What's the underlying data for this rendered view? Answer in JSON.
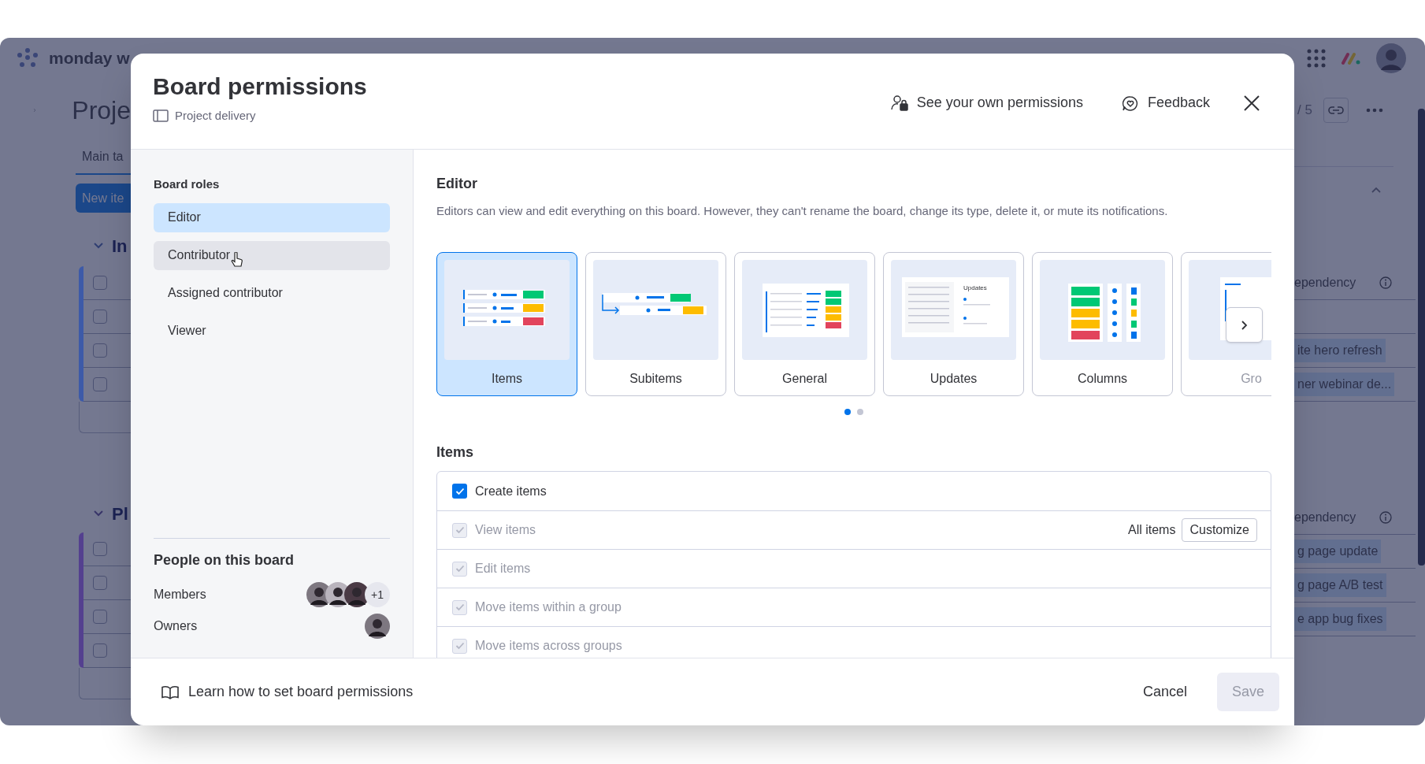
{
  "background_app": {
    "logo": "monday w",
    "board_title": "Proje",
    "view_tab": "Main ta",
    "new_item_button": "New ite",
    "page_counter": "/ 5",
    "groups": [
      {
        "name": "In",
        "color": "#3d5aa8",
        "dependency_header": "ependency",
        "cells": [
          "",
          "ite hero refresh",
          "ner webinar de..."
        ],
        "rows": [
          {
            "checked": false
          },
          {
            "checked": false
          },
          {
            "checked": false
          },
          {
            "checked": false
          }
        ]
      },
      {
        "name": "Pl",
        "color": "#54408f",
        "dependency_header": "ependency",
        "cells": [
          "g page update",
          "g page A/B test",
          "e app bug fixes"
        ],
        "rows": [
          {
            "checked": false
          },
          {
            "checked": false
          },
          {
            "checked": false
          },
          {
            "checked": false
          }
        ]
      }
    ]
  },
  "dialog": {
    "title": "Board permissions",
    "board_name": "Project delivery",
    "header_actions": [
      {
        "kind": "permissions",
        "label": "See your own permissions"
      },
      {
        "kind": "feedback",
        "label": "Feedback"
      }
    ],
    "roles": {
      "heading": "Board roles",
      "items": [
        {
          "label": "Editor",
          "selected": true,
          "hovered": false
        },
        {
          "label": "Contributor",
          "selected": false,
          "hovered": true
        },
        {
          "label": "Assigned contributor",
          "selected": false,
          "hovered": false
        },
        {
          "label": "Viewer",
          "selected": false,
          "hovered": false
        }
      ]
    },
    "people": {
      "heading": "People on this board",
      "groups": [
        {
          "label": "Members",
          "avatars": [
            {
              "kind": "avatar"
            },
            {
              "kind": "avatar"
            },
            {
              "kind": "avatar"
            }
          ],
          "more": "+1"
        },
        {
          "label": "Owners",
          "avatars": [
            {
              "kind": "avatar"
            }
          ]
        }
      ]
    },
    "role_detail": {
      "title": "Editor",
      "description": "Editors can view and edit everything on this board. However, they can't rename the board, change its type, delete it, or mute its notifications.",
      "categories": [
        {
          "kind": "items",
          "label": "Items",
          "selected": true
        },
        {
          "kind": "subitems",
          "label": "Subitems",
          "selected": false
        },
        {
          "kind": "general",
          "label": "General",
          "selected": false
        },
        {
          "kind": "updates",
          "label": "Updates",
          "selected": false,
          "preview_heading": "Updates"
        },
        {
          "kind": "columns",
          "label": "Columns",
          "selected": false
        },
        {
          "kind": "groups",
          "label": "Gro",
          "selected": false
        }
      ],
      "pages": [
        {
          "selected": true
        },
        {
          "selected": false
        }
      ]
    },
    "section": {
      "title": "Items",
      "permissions": [
        {
          "label": "Create items",
          "checked": true,
          "disabled": false
        },
        {
          "label": "View items",
          "checked": true,
          "disabled": true,
          "scope": "All items",
          "action": "Customize"
        },
        {
          "label": "Edit items",
          "checked": true,
          "disabled": true
        },
        {
          "label": "Move items within a group",
          "checked": true,
          "disabled": true
        },
        {
          "label": "Move items across groups",
          "checked": true,
          "disabled": true
        }
      ]
    }
  },
  "footer": {
    "help_link": "Learn how to set board permissions",
    "cancel": "Cancel",
    "save": {
      "label": "Save",
      "disabled": true
    }
  }
}
